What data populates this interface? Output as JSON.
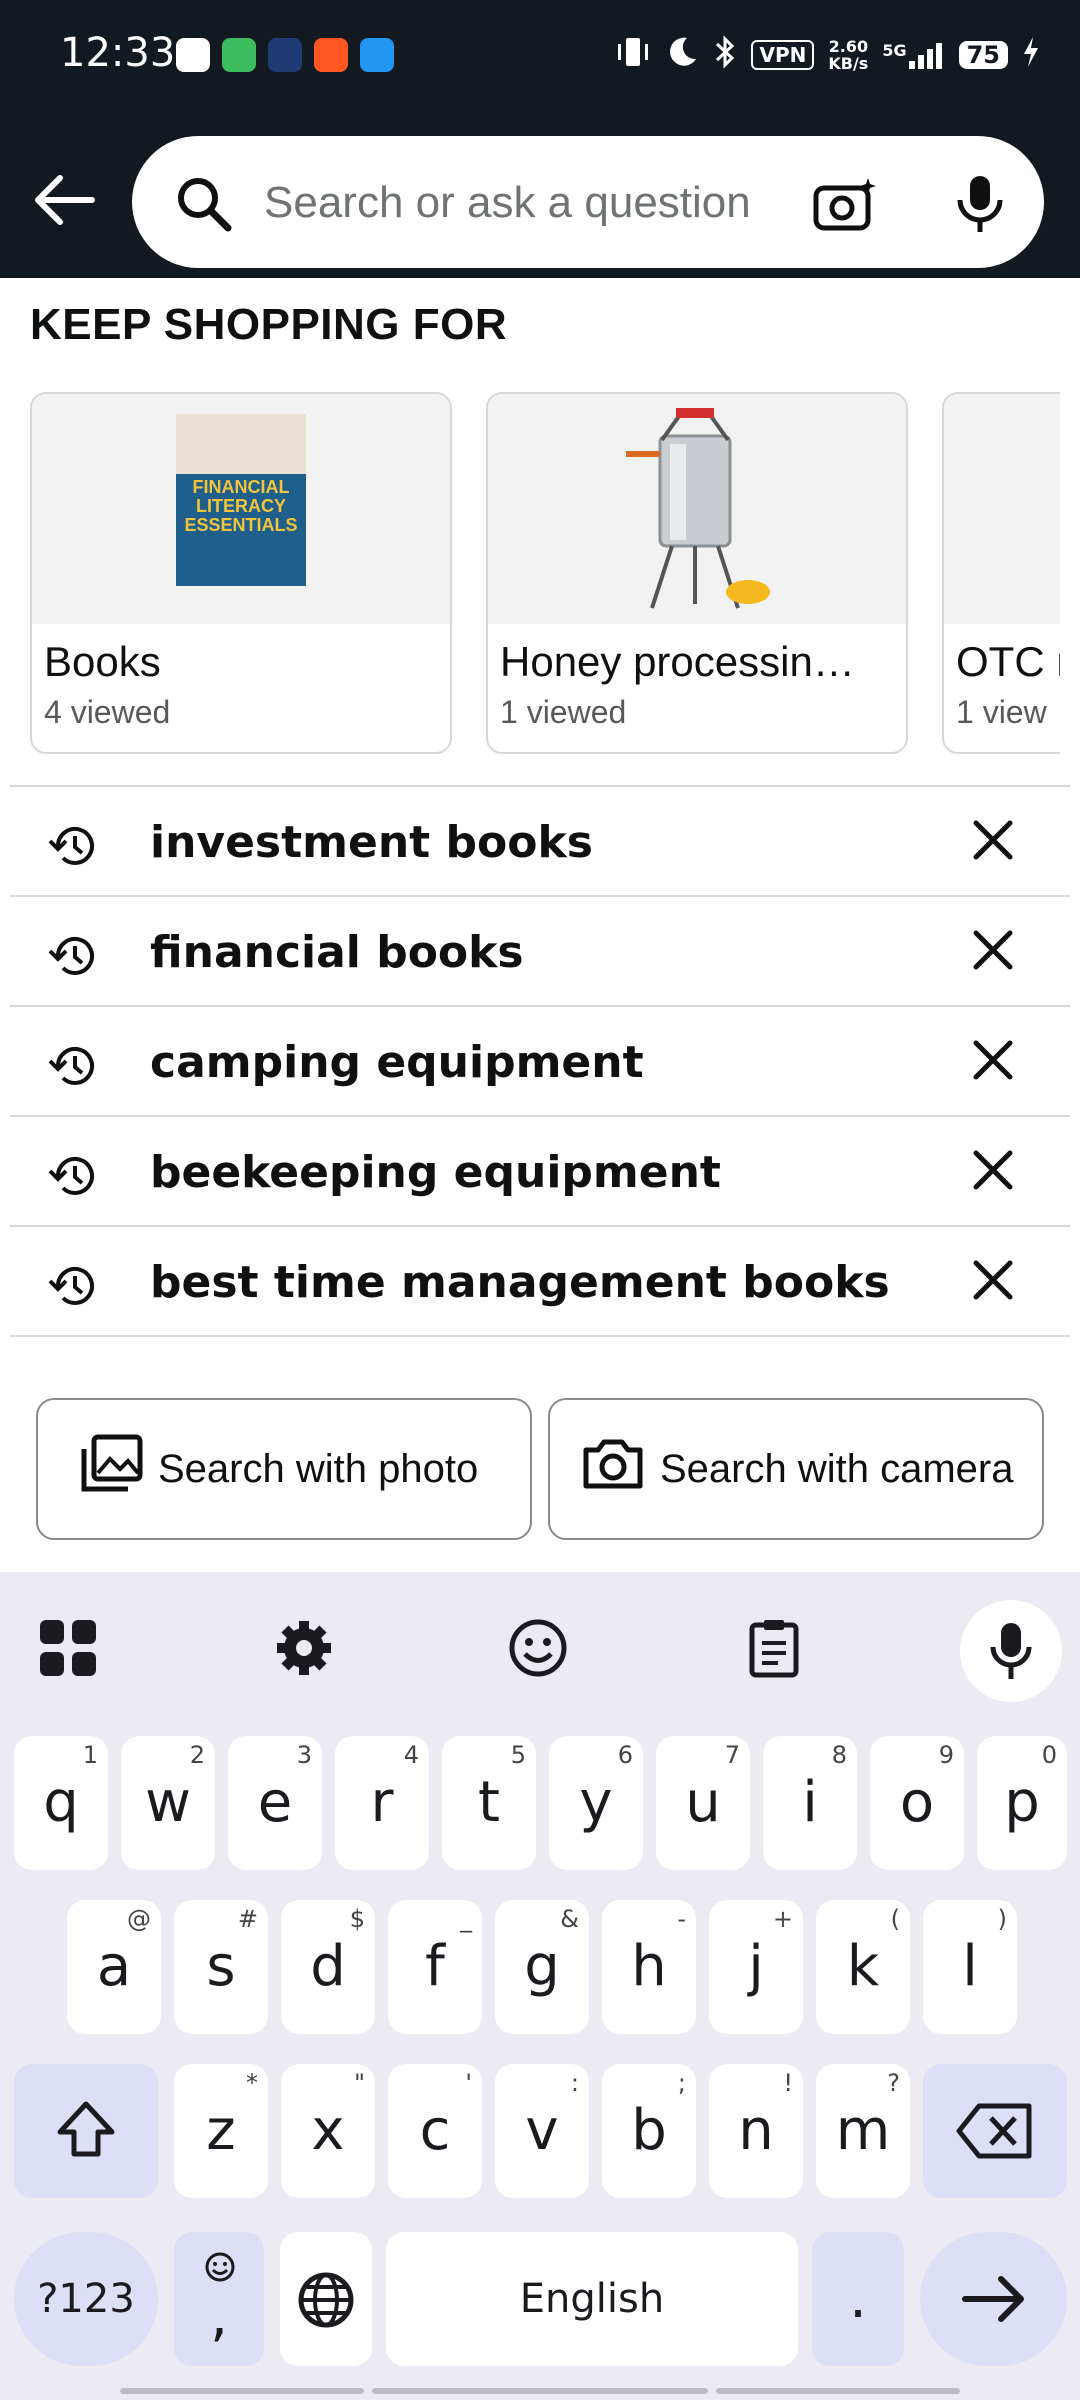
{
  "status_bar": {
    "time": "12:33",
    "vpn": "VPN",
    "speed_value": "2.60",
    "speed_unit": "KB/s",
    "network": "5G",
    "battery": "75"
  },
  "search": {
    "placeholder": "Search or ask a question"
  },
  "keep_shopping": {
    "title": "KEEP SHOPPING FOR",
    "cards": [
      {
        "name": "Books",
        "sub": "4 viewed",
        "book_title": "FINANCIAL LITERACY ESSENTIALS"
      },
      {
        "name": "Honey processin…",
        "sub": "1 viewed"
      },
      {
        "name": "OTC r",
        "sub": "1 view"
      }
    ]
  },
  "history": [
    {
      "text": "investment books"
    },
    {
      "text": "financial books"
    },
    {
      "text": "camping equipment"
    },
    {
      "text": "beekeeping equipment"
    },
    {
      "text": "best time management books"
    }
  ],
  "actions": {
    "photo": "Search with photo",
    "camera": "Search with camera"
  },
  "keyboard": {
    "row1": [
      {
        "k": "q",
        "h": "1"
      },
      {
        "k": "w",
        "h": "2"
      },
      {
        "k": "e",
        "h": "3"
      },
      {
        "k": "r",
        "h": "4"
      },
      {
        "k": "t",
        "h": "5"
      },
      {
        "k": "y",
        "h": "6"
      },
      {
        "k": "u",
        "h": "7"
      },
      {
        "k": "i",
        "h": "8"
      },
      {
        "k": "o",
        "h": "9"
      },
      {
        "k": "p",
        "h": "0"
      }
    ],
    "row2": [
      {
        "k": "a",
        "h": "@"
      },
      {
        "k": "s",
        "h": "#"
      },
      {
        "k": "d",
        "h": "$"
      },
      {
        "k": "f",
        "h": "_"
      },
      {
        "k": "g",
        "h": "&"
      },
      {
        "k": "h",
        "h": "-"
      },
      {
        "k": "j",
        "h": "+"
      },
      {
        "k": "k",
        "h": "("
      },
      {
        "k": "l",
        "h": ")"
      }
    ],
    "row3": [
      {
        "k": "z",
        "h": "*"
      },
      {
        "k": "x",
        "h": "\""
      },
      {
        "k": "c",
        "h": "'"
      },
      {
        "k": "v",
        "h": ":"
      },
      {
        "k": "b",
        "h": ";"
      },
      {
        "k": "n",
        "h": "!"
      },
      {
        "k": "m",
        "h": "?"
      }
    ],
    "symbols": "?123",
    "comma": ",",
    "space": "English",
    "period": "."
  },
  "colors": {
    "header_bg": "#131921",
    "keyboard_bg": "#eceaf3",
    "func_key": "#dcdff6"
  }
}
